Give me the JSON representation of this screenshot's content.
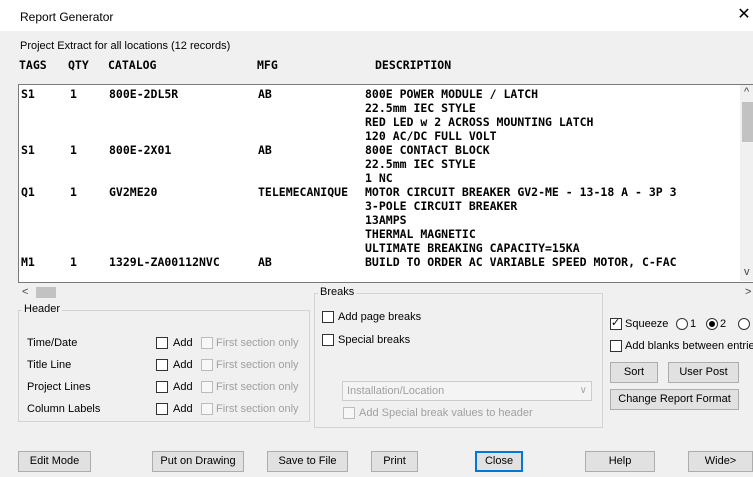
{
  "window": {
    "title": "Report Generator",
    "close_glyph": "✕"
  },
  "subtitle": "Project Extract for all locations (12 records)",
  "columns": {
    "tags": "TAGS",
    "qty": "QTY",
    "catalog": "CATALOG",
    "mfg": "MFG",
    "description": "DESCRIPTION"
  },
  "rows": [
    {
      "tag": "S1",
      "qty": "1",
      "catalog": "800E-2DL5R",
      "mfg": "AB",
      "desc": [
        "800E POWER MODULE / LATCH",
        "22.5mm IEC STYLE",
        "RED LED w 2 ACROSS MOUNTING LATCH",
        "120 AC/DC FULL VOLT"
      ]
    },
    {
      "tag": "S1",
      "qty": "1",
      "catalog": "800E-2X01",
      "mfg": "AB",
      "desc": [
        "800E CONTACT BLOCK",
        "22.5mm IEC STYLE",
        "1 NC"
      ]
    },
    {
      "tag": "Q1",
      "qty": "1",
      "catalog": "GV2ME20",
      "mfg": "TELEMECANIQUE",
      "desc": [
        "MOTOR CIRCUIT BREAKER GV2-ME - 13-18 A - 3P 3",
        "3-POLE CIRCUIT BREAKER",
        "13AMPS",
        "THERMAL MAGNETIC",
        "ULTIMATE BREAKING CAPACITY=15KA"
      ]
    },
    {
      "tag": "M1",
      "qty": "1",
      "catalog": "1329L-ZA00112NVC",
      "mfg": "AB",
      "desc": [
        "BUILD TO ORDER AC VARIABLE SPEED MOTOR, C-FAC"
      ]
    }
  ],
  "header_group": {
    "title": "Header",
    "add_label": "Add",
    "first_label": "First section only",
    "items": [
      "Time/Date",
      "Title Line",
      "Project Lines",
      "Column Labels"
    ]
  },
  "breaks_group": {
    "title": "Breaks",
    "add_page_breaks": "Add page breaks",
    "special_breaks": "Special breaks",
    "combo_value": "Installation/Location",
    "add_special_values": "Add Special break values to header"
  },
  "options": {
    "squeeze": "Squeeze",
    "radio_labels": [
      "1",
      "2"
    ],
    "add_blanks": "Add blanks between entrie",
    "sort": "Sort",
    "user_post": "User Post",
    "change_format": "Change Report Format"
  },
  "buttons": {
    "edit_mode": "Edit Mode",
    "put_on_drawing": "Put on Drawing",
    "save_to_file": "Save to File",
    "print": "Print",
    "close": "Close",
    "help": "Help",
    "wide": "Wide>"
  }
}
